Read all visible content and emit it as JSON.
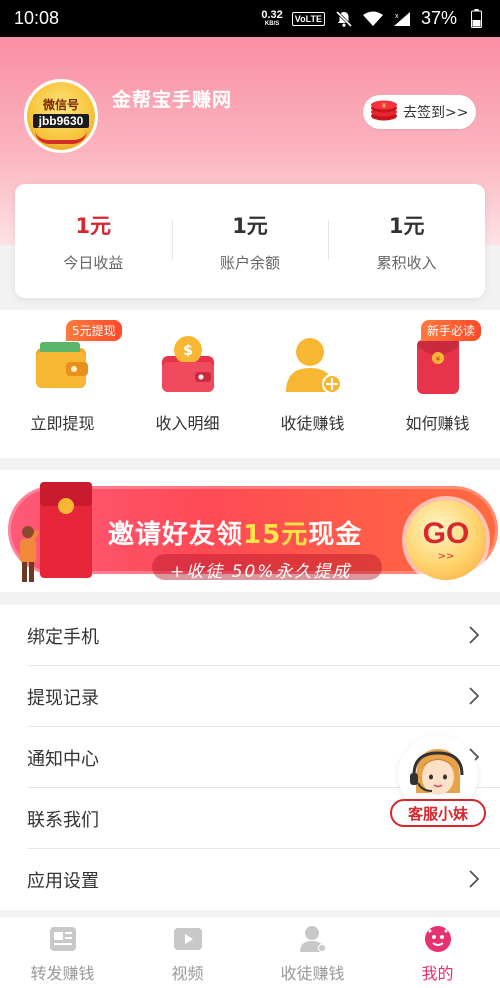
{
  "status_bar": {
    "time": "10:08",
    "net_speed_value": "0.32",
    "net_speed_unit": "KB/S",
    "volte": "VoLTE",
    "battery": "37%"
  },
  "profile": {
    "avatar_line1": "微信号",
    "avatar_line2": "jbb9630",
    "app_name": "金帮宝手赚网",
    "checkin_label": "去签到>>"
  },
  "stats": [
    {
      "value": "1元",
      "label": "今日收益",
      "highlight": true
    },
    {
      "value": "1元",
      "label": "账户余额",
      "highlight": false
    },
    {
      "value": "1元",
      "label": "累积收入",
      "highlight": false
    }
  ],
  "quick_actions": [
    {
      "label": "立即提现",
      "badge": "5元提现",
      "icon": "wallet-icon"
    },
    {
      "label": "收入明细",
      "badge": "",
      "icon": "money-bag-icon"
    },
    {
      "label": "收徒赚钱",
      "badge": "",
      "icon": "add-user-icon"
    },
    {
      "label": "如何赚钱",
      "badge": "新手必读",
      "icon": "red-envelope-icon"
    }
  ],
  "banner": {
    "title_a": "邀请好友领",
    "title_b": "15元",
    "title_c": "现金",
    "subtitle": "+收徒 50%永久提成",
    "go": "GO",
    "go_arrow": ">>"
  },
  "menu": [
    {
      "label": "绑定手机"
    },
    {
      "label": "提现记录"
    },
    {
      "label": "通知中心"
    },
    {
      "label": "联系我们"
    },
    {
      "label": "应用设置"
    }
  ],
  "customer_service": {
    "label": "客服小妹"
  },
  "tabs": [
    {
      "label": "转发赚钱",
      "icon": "article-icon",
      "active": false
    },
    {
      "label": "视频",
      "icon": "video-icon",
      "active": false
    },
    {
      "label": "收徒赚钱",
      "icon": "user-icon",
      "active": false
    },
    {
      "label": "我的",
      "icon": "profile-icon",
      "active": true
    }
  ],
  "colors": {
    "accent_red": "#d9272e",
    "active_tab": "#e8316f",
    "header_pink": "#f98fa4"
  }
}
